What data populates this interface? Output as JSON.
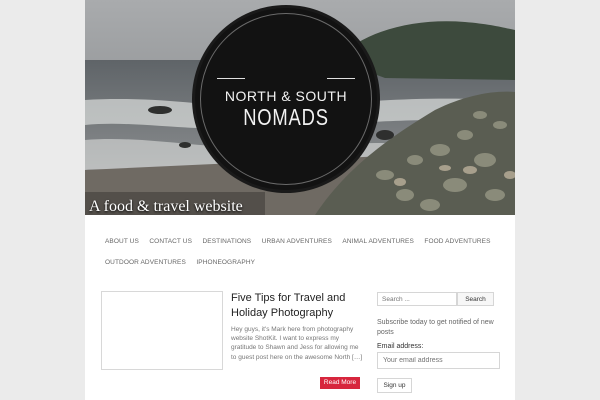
{
  "header": {
    "logo_line1": "NORTH & SOUTH",
    "logo_line2": "NOMADS",
    "tagline": "A food & travel website"
  },
  "nav": {
    "row1": [
      "ABOUT US",
      "CONTACT US",
      "DESTINATIONS",
      "URBAN ADVENTURES",
      "ANIMAL ADVENTURES",
      "FOOD ADVENTURES"
    ],
    "row2": [
      "OUTDOOR ADVENTURES",
      "IPHONEOGRAPHY"
    ]
  },
  "post": {
    "title": "Five Tips for Travel and Holiday Photography",
    "excerpt": "Hey guys, it's Mark here from photography website ShotKit. I want to express my gratitude to Shawn and Jess for allowing me to guest post here on the awesome North […]",
    "read_more": "Read More"
  },
  "sidebar": {
    "search_placeholder": "Search ...",
    "search_button": "Search",
    "subscribe_text": "Subscribe today to get notified of new posts",
    "email_label": "Email address:",
    "email_placeholder": "Your email address",
    "signup_button": "Sign up"
  },
  "colors": {
    "page_bg": "#ebebeb",
    "read_more_bg": "#d7263d",
    "logo_bg": "#121212"
  }
}
